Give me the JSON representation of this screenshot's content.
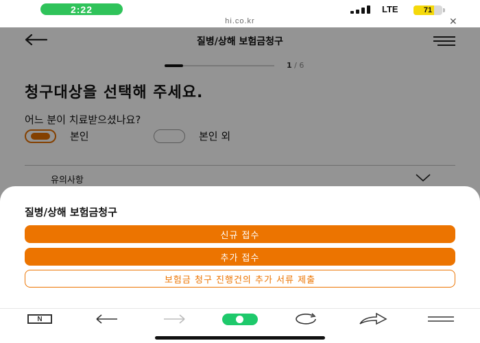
{
  "status_bar": {
    "time": "2:22",
    "network": "LTE",
    "battery": "71",
    "battery_level": 0.71,
    "url": "hi.co.kr",
    "close_glyph": "✕"
  },
  "header": {
    "title": "질병/상해 보험금청구",
    "back_icon": "arrow-left-icon",
    "menu_icon": "hamburger-menu-icon"
  },
  "progress": {
    "current": "1",
    "separator": "/",
    "total": "6",
    "fraction": 0.1667
  },
  "main": {
    "headline": "청구대상을 선택해 주세요.",
    "question": "어느 분이 치료받으셨나요?",
    "options": [
      {
        "label": "본인",
        "selected": true
      },
      {
        "label": "본인 외",
        "selected": false
      }
    ],
    "notice_label": "유의사항"
  },
  "sheet": {
    "title": "질병/상해 보험금청구",
    "buttons": [
      {
        "label": "신규 접수",
        "style": "primary"
      },
      {
        "label": "추가 접수",
        "style": "primary"
      },
      {
        "label": "보험금 청구 진행건의 추가 서류 제출",
        "style": "outline"
      }
    ]
  },
  "toolbar": {
    "naver_label": "N",
    "items": [
      "naver-icon",
      "back-icon",
      "forward-icon",
      "home-icon",
      "refresh-icon",
      "share-icon",
      "menu-icon"
    ]
  },
  "colors": {
    "accent": "#ec7400",
    "status_green": "#2fc35a",
    "nav_green": "#1ec96b",
    "battery": "#f5d90a"
  }
}
